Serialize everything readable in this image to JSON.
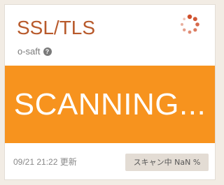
{
  "card": {
    "title": "SSL/TLS",
    "source": "o-saft",
    "status_text": "SCANNING...",
    "updated_at": "09/21 21:22 更新",
    "progress_label": "スキャン中 NaN %"
  },
  "icons": {
    "help": "question-circle-icon",
    "status": "loading-spinner-icon"
  },
  "colors": {
    "title": "#b85a2c",
    "status_panel": "#f7931e",
    "spinner": "#cf4f2b",
    "badge_bg": "#e3dcd4",
    "page_bg": "#f2ece4"
  }
}
